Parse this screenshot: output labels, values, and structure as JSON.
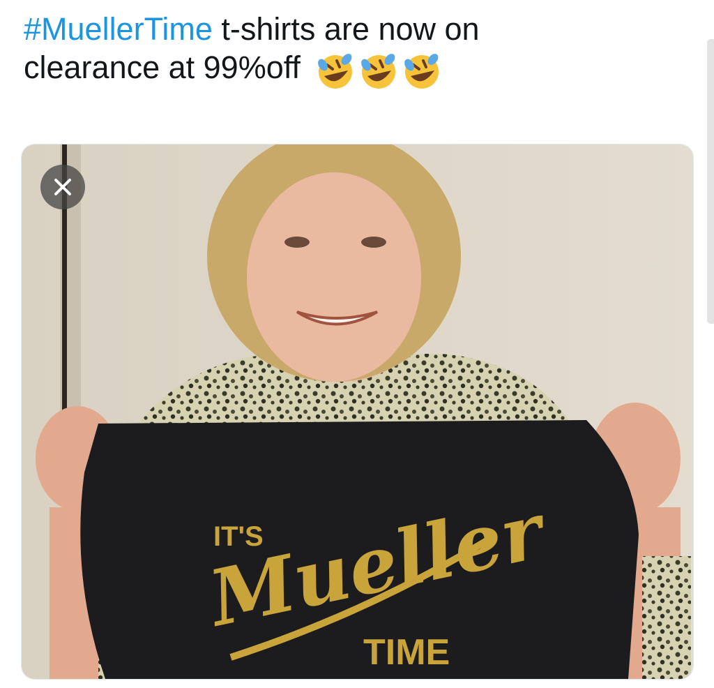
{
  "tweet": {
    "hashtag": "#MuellerTime",
    "text_line1_rest": " t-shirts are now on",
    "text_line2": "clearance at 99%off",
    "emojis": [
      "rolling-on-floor-laughing-emoji",
      "rolling-on-floor-laughing-emoji",
      "rolling-on-floor-laughing-emoji"
    ]
  },
  "media": {
    "close_icon": "close-icon",
    "shirt_text": {
      "its": "IT'S",
      "brand": "Mueller",
      "time": "TIME"
    }
  },
  "colors": {
    "hashtag": "#1b95e0",
    "text": "#14171a",
    "shirt": "#1c1c1e",
    "shirt_print": "#c9a43a"
  }
}
